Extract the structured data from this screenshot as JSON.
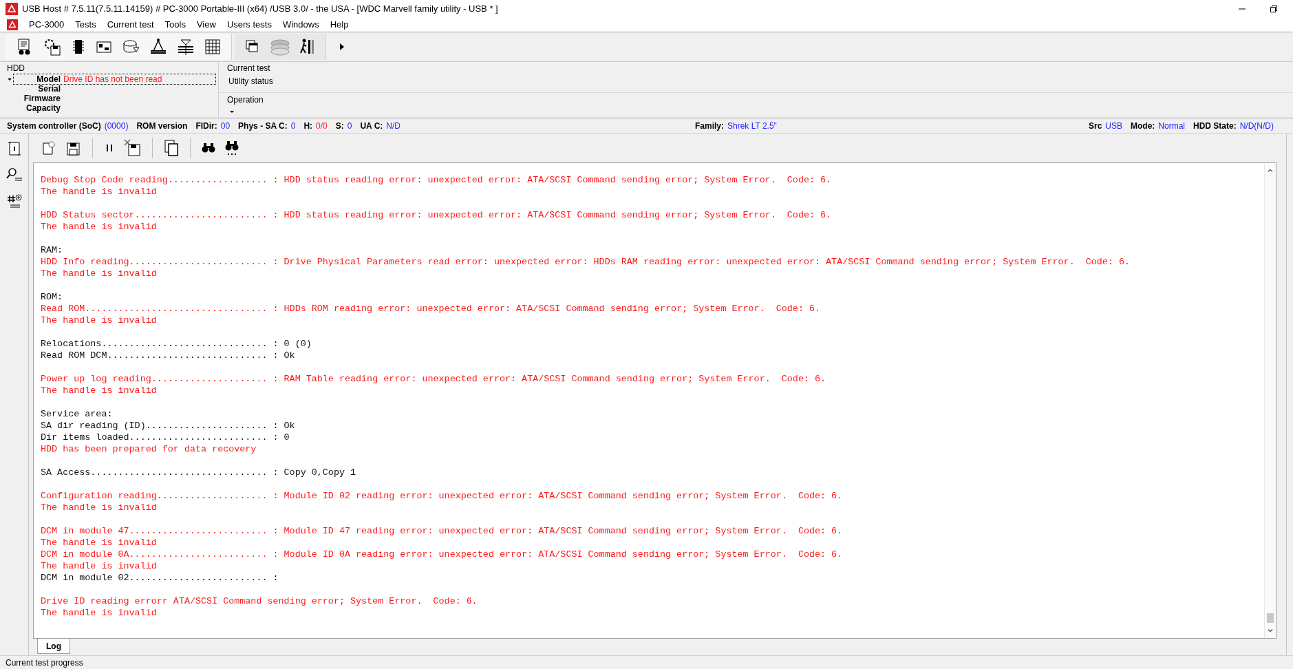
{
  "window": {
    "title": "USB Host # 7.5.11(7.5.11.14159) # PC-3000 Portable-III (x64) /USB 3.0/ - the USA - [WDC Marvell family utility - USB * ]"
  },
  "menu": [
    "PC-3000",
    "Tests",
    "Current test",
    "Tools",
    "View",
    "Users tests",
    "Windows",
    "Help"
  ],
  "hdd_panel": {
    "title": "HDD",
    "fields": [
      {
        "label": "Model",
        "value": "Drive ID has not been read",
        "selected": true
      },
      {
        "label": "Serial",
        "selected": false
      },
      {
        "label": "Firmware",
        "selected": false
      },
      {
        "label": "Capacity",
        "selected": false
      }
    ]
  },
  "current_test": {
    "title": "Current test",
    "value": "Utility status"
  },
  "operation": {
    "title": "Operation"
  },
  "info_bar": {
    "left": [
      {
        "label": "System controller (SoC)",
        "value": "(0000)",
        "kind": "info"
      },
      {
        "label": "ROM version"
      },
      {
        "label": "FIDir:",
        "value": "00",
        "kind": "info"
      },
      {
        "label": "Phys - SA C:",
        "value": "0",
        "kind": "info"
      },
      {
        "label": "H:",
        "value": "0/0",
        "kind": "error"
      },
      {
        "label": "S:",
        "value": "0",
        "kind": "info"
      },
      {
        "label": "UA C:",
        "value": "N/D",
        "kind": "info"
      }
    ],
    "center": [
      {
        "label": "Family:",
        "value": "Shrek LT 2.5\"",
        "kind": "info"
      }
    ],
    "right": [
      {
        "label": "Src",
        "value": "USB",
        "kind": "info"
      },
      {
        "label": "Mode:",
        "value": "Normal",
        "kind": "info"
      },
      {
        "label": "HDD State:",
        "value": "N/D(N/D)",
        "kind": "info"
      }
    ]
  },
  "log": {
    "lines": [
      {
        "kind": "error",
        "text": "Debug Stop Code reading.................. : HDD status reading error: unexpected error: ATA/SCSI Command sending error; System Error.  Code: 6."
      },
      {
        "kind": "error",
        "text": "The handle is invalid"
      },
      {
        "kind": "blank"
      },
      {
        "kind": "error",
        "text": "HDD Status sector........................ : HDD status reading error: unexpected error: ATA/SCSI Command sending error; System Error.  Code: 6."
      },
      {
        "kind": "error",
        "text": "The handle is invalid"
      },
      {
        "kind": "blank"
      },
      {
        "kind": "normal",
        "text": "RAM:"
      },
      {
        "kind": "error",
        "text": "HDD Info reading......................... : Drive Physical Parameters read error: unexpected error: HDDs RAM reading error: unexpected error: ATA/SCSI Command sending error; System Error.  Code: 6."
      },
      {
        "kind": "error",
        "text": "The handle is invalid"
      },
      {
        "kind": "blank"
      },
      {
        "kind": "normal",
        "text": "ROM:"
      },
      {
        "kind": "error",
        "text": "Read ROM................................. : HDDs ROM reading error: unexpected error: ATA/SCSI Command sending error; System Error.  Code: 6."
      },
      {
        "kind": "error",
        "text": "The handle is invalid"
      },
      {
        "kind": "blank"
      },
      {
        "kind": "normal",
        "text": "Relocations.............................. : 0 (0)"
      },
      {
        "kind": "normal",
        "text": "Read ROM DCM............................. : Ok"
      },
      {
        "kind": "blank"
      },
      {
        "kind": "error",
        "text": "Power up log reading..................... : RAM Table reading error: unexpected error: ATA/SCSI Command sending error; System Error.  Code: 6."
      },
      {
        "kind": "error",
        "text": "The handle is invalid"
      },
      {
        "kind": "blank"
      },
      {
        "kind": "normal",
        "text": "Service area:"
      },
      {
        "kind": "normal",
        "text": "SA dir reading (ID)...................... : Ok"
      },
      {
        "kind": "normal",
        "text": "Dir items loaded......................... : 0"
      },
      {
        "kind": "error",
        "text": "HDD has been prepared for data recovery"
      },
      {
        "kind": "blank"
      },
      {
        "kind": "normal",
        "text": "SA Access................................ : Copy 0,Copy 1"
      },
      {
        "kind": "blank"
      },
      {
        "kind": "error",
        "text": "Configuration reading.................... : Module ID 02 reading error: unexpected error: ATA/SCSI Command sending error; System Error.  Code: 6."
      },
      {
        "kind": "error",
        "text": "The handle is invalid"
      },
      {
        "kind": "blank"
      },
      {
        "kind": "error",
        "text": "DCM in module 47......................... : Module ID 47 reading error: unexpected error: ATA/SCSI Command sending error; System Error.  Code: 6."
      },
      {
        "kind": "error",
        "text": "The handle is invalid"
      },
      {
        "kind": "error",
        "text": "DCM in module 0A......................... : Module ID 0A reading error: unexpected error: ATA/SCSI Command sending error; System Error.  Code: 6."
      },
      {
        "kind": "error",
        "text": "The handle is invalid"
      },
      {
        "kind": "normal",
        "text": "DCM in module 02......................... :"
      },
      {
        "kind": "blank"
      },
      {
        "kind": "error",
        "text": "Drive ID reading errorr ATA/SCSI Command sending error; System Error.  Code: 6."
      },
      {
        "kind": "error",
        "text": "The handle is invalid"
      }
    ]
  },
  "tabs": [
    {
      "label": "Log",
      "selected": true
    }
  ],
  "status_bar": "Current test progress"
}
